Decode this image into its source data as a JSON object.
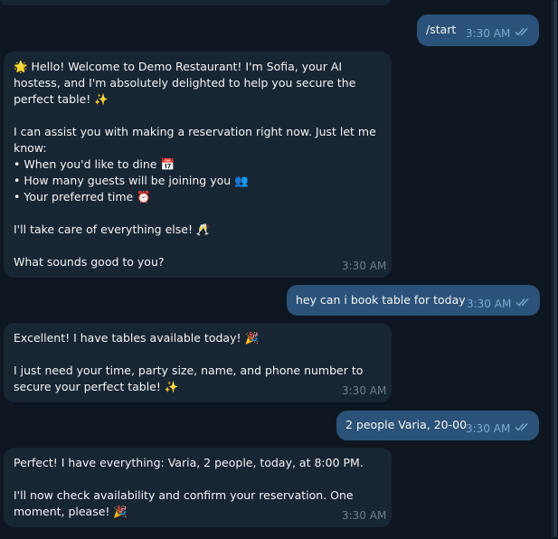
{
  "colors": {
    "background": "#0e1621",
    "incoming_bubble": "#182533",
    "outgoing_bubble": "#2b5278",
    "read_check": "#7da8d3"
  },
  "messages": [
    {
      "direction": "out",
      "text": "/start",
      "time": "3:30 AM",
      "status": "read"
    },
    {
      "direction": "in",
      "text": "🌟 Hello! Welcome to Demo Restaurant! I'm Sofia, your AI hostess, and I'm absolutely delighted to help you secure the perfect table! ✨\n\nI can assist you with making a reservation right now. Just let me know:\n• When you'd like to dine 📅\n• How many guests will be joining you 👥\n• Your preferred time ⏰\n\nI'll take care of everything else! 🥂\n\nWhat sounds good to you?",
      "time": "3:30 AM"
    },
    {
      "direction": "out",
      "text": "hey can i book table for today",
      "time": "3:30 AM",
      "status": "read"
    },
    {
      "direction": "in",
      "text": "Excellent! I have tables available today! 🎉\n\nI just need your time, party size, name, and phone number to secure your perfect table! ✨",
      "time": "3:30 AM"
    },
    {
      "direction": "out",
      "text": "2 people Varia, 20-00",
      "time": "3:30 AM",
      "status": "read"
    },
    {
      "direction": "in",
      "text": "Perfect! I have everything: Varia, 2 people, today, at 8:00 PM.\n\nI'll now check availability and confirm your reservation. One moment, please! 🎉",
      "time": "3:30 AM"
    }
  ]
}
